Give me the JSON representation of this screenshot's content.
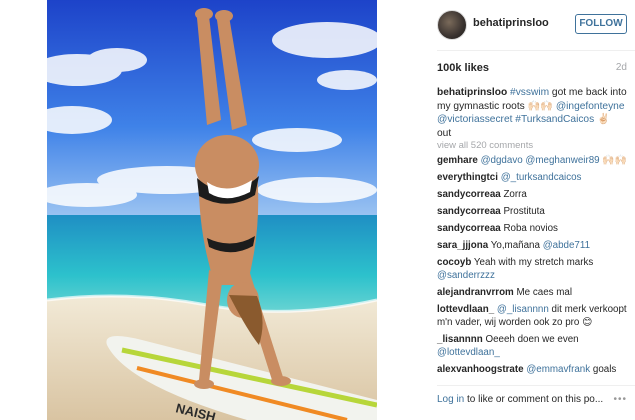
{
  "post": {
    "username": "behatiprinsloo",
    "follow_label": "FOLLOW",
    "likes": "100k likes",
    "time": "2d",
    "caption": {
      "user": "behatiprinsloo",
      "tag1": "#vsswim",
      "text1": " got me back into my gymnastic roots ",
      "emoji1": "🙌🏻🙌🏻",
      "tag2": "@ingefonteyne",
      "tag3": "@victoriassecret",
      "tag4": "#TurksandCaicos",
      "text2": " ✌🏻",
      "text3": "out"
    },
    "view_all": "view all 520 comments",
    "comments": [
      {
        "user": "gemhare",
        "parts": [
          {
            "t": "@dgdavo",
            "tag": true
          },
          {
            "t": " ",
            "tag": false
          },
          {
            "t": "@meghanweir89",
            "tag": true
          },
          {
            "t": " 🙌🏻🙌🏻",
            "tag": false
          }
        ]
      },
      {
        "user": "everythingtci",
        "parts": [
          {
            "t": "@_turksandcaicos",
            "tag": true
          }
        ]
      },
      {
        "user": "sandycorreaa",
        "parts": [
          {
            "t": "Zorra",
            "tag": false
          }
        ]
      },
      {
        "user": "sandycorreaa",
        "parts": [
          {
            "t": "Prostituta",
            "tag": false
          }
        ]
      },
      {
        "user": "sandycorreaa",
        "parts": [
          {
            "t": "Roba novios",
            "tag": false
          }
        ]
      },
      {
        "user": "sara_jjjona",
        "parts": [
          {
            "t": "Yo,mañana ",
            "tag": false
          },
          {
            "t": "@abde711",
            "tag": true
          }
        ]
      },
      {
        "user": "cocoyb",
        "parts": [
          {
            "t": "Yeah with my stretch marks ",
            "tag": false
          },
          {
            "t": "@sanderrzzz",
            "tag": true
          }
        ]
      },
      {
        "user": "alejandranvrrom",
        "parts": [
          {
            "t": "Me caes mal",
            "tag": false
          }
        ]
      },
      {
        "user": "lottevdlaan_",
        "parts": [
          {
            "t": "@_lisannnn",
            "tag": true
          },
          {
            "t": " dit merk verkoopt m'n vader, wij worden ook zo pro 😊",
            "tag": false
          }
        ]
      },
      {
        "user": "_lisannnn",
        "parts": [
          {
            "t": "Oeeeh doen we even ",
            "tag": false
          },
          {
            "t": "@lottevdlaan_",
            "tag": true
          }
        ]
      },
      {
        "user": "alexvanhoogstrate",
        "parts": [
          {
            "t": "@emmavfrank",
            "tag": true
          },
          {
            "t": " goals",
            "tag": false
          }
        ]
      }
    ],
    "footer": {
      "login": "Log in",
      "rest": " to like or comment on this po...",
      "more": "•••"
    }
  },
  "photo": {
    "description_icon": "handstand-beach-photo",
    "board_text": "NAISH",
    "colors": {
      "sky_top": "#1f4fd6",
      "sky_bottom": "#7fb4ee",
      "sea": "#27b5c8",
      "sand": "#e9dcc3",
      "skin": "#c98d62",
      "board": "#f2f3ee",
      "board_stripe": "#b7d63a"
    }
  },
  "colors": {
    "link": "#3f729b",
    "muted": "#a5a7aa",
    "text": "#262626"
  }
}
